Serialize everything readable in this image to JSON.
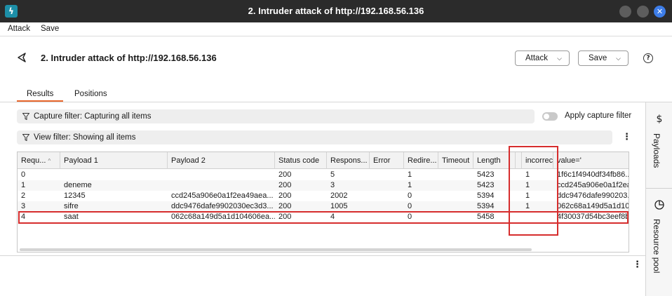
{
  "window": {
    "title": "2. Intruder attack of http://192.168.56.136",
    "app_icon": "burp-bolt-icon",
    "close_glyph": "✕"
  },
  "menu": {
    "items": [
      "Attack",
      "Save"
    ]
  },
  "header": {
    "title": "2. Intruder attack of http://192.168.56.136",
    "attack_button": "Attack",
    "save_button": "Save",
    "help": "?",
    "chevron": "⌵"
  },
  "tabs": [
    {
      "label": "Results",
      "active": true
    },
    {
      "label": "Positions",
      "active": false
    }
  ],
  "filters": {
    "capture": "Capture filter: Capturing all items",
    "view": "View filter: Showing all items",
    "apply_capture": "Apply capture filter",
    "kebab": "⋮"
  },
  "table": {
    "columns": [
      "Requ...",
      "Payload 1",
      "Payload 2",
      "Status code",
      "Respons...",
      "Error",
      "Redire...",
      "Timeout",
      "Length",
      "",
      "incorrect",
      "value='"
    ],
    "sort_indicator": "^",
    "rows": [
      [
        "0",
        "",
        "",
        "200",
        "5",
        "",
        "1",
        "",
        "5423",
        "",
        "1",
        "1f6c1f4940df34fb86..."
      ],
      [
        "1",
        "deneme",
        "",
        "200",
        "3",
        "",
        "1",
        "",
        "5423",
        "",
        "1",
        "ccd245a906e0a1f2ea..."
      ],
      [
        "2",
        "12345",
        "ccd245a906e0a1f2ea49aea...",
        "200",
        "2002",
        "",
        "0",
        "",
        "5394",
        "",
        "1",
        "ddc9476dafe990203..."
      ],
      [
        "3",
        "sifre",
        "ddc9476dafe9902030ec3d3...",
        "200",
        "1005",
        "",
        "0",
        "",
        "5394",
        "",
        "1",
        "062c68a149d5a1d104"
      ],
      [
        "4",
        "saat",
        "062c68a149d5a1d104606ea...",
        "200",
        "4",
        "",
        "0",
        "",
        "5458",
        "",
        "",
        "4f30037d54bc3eef8b"
      ]
    ]
  },
  "right_rail": {
    "payloads_label": "Payloads",
    "payloads_icon": "dollar-icon",
    "resource_pool_label": "Resource pool",
    "resource_pool_icon": "pie-chart-icon"
  },
  "colors": {
    "accent": "#e8672c",
    "annotation_red": "#d62d2d",
    "titlebar": "#2b2b2b"
  }
}
